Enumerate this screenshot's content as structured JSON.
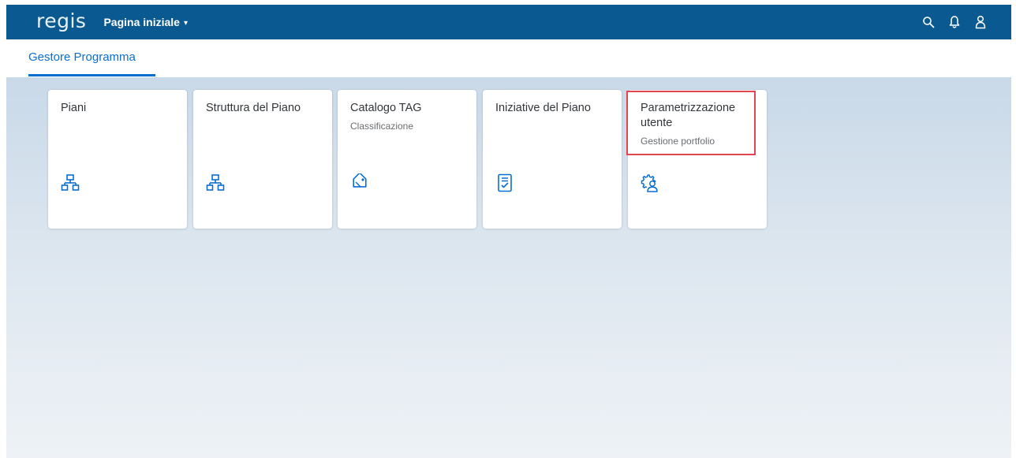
{
  "shell": {
    "logo": "regis",
    "home_label": "Pagina iniziale",
    "caret": "▾"
  },
  "tabs": [
    {
      "label": "Gestore Programma",
      "selected": true
    }
  ],
  "tiles": [
    {
      "title": "Piani",
      "subtitle": "",
      "icon": "hierarchy-icon"
    },
    {
      "title": "Struttura del Piano",
      "subtitle": "",
      "icon": "hierarchy-icon"
    },
    {
      "title": "Catalogo TAG",
      "subtitle": "Classificazione",
      "icon": "tag-icon"
    },
    {
      "title": "Iniziative del Piano",
      "subtitle": "",
      "icon": "checklist-document-icon"
    },
    {
      "title": "Parametrizzazione utente",
      "subtitle": "Gestione portfolio",
      "icon": "user-settings-icon"
    }
  ],
  "colors": {
    "shell_bar": "#0a5a91",
    "accent": "#0a6ed1",
    "highlight": "#e0464f"
  }
}
